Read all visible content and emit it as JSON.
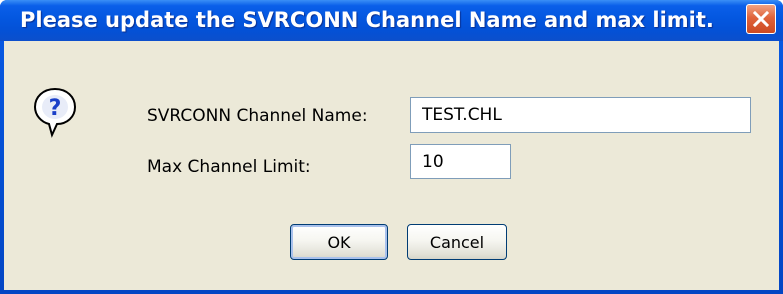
{
  "dialog": {
    "title": "Please update the SVRCONN Channel Name and max limit.",
    "close_icon": "close-x",
    "help_icon": "question-speech-bubble",
    "fields": {
      "channel_name_label": "SVRCONN Channel Name:",
      "channel_name_value": "TEST.CHL",
      "max_limit_label": "Max Channel Limit:",
      "max_limit_value": "10"
    },
    "buttons": {
      "ok_label": "OK",
      "cancel_label": "Cancel"
    }
  },
  "colors": {
    "titlebar": "#0457e0",
    "client_background": "#ece9d8",
    "close_button": "#e0633b",
    "field_border": "#7f9db9"
  }
}
